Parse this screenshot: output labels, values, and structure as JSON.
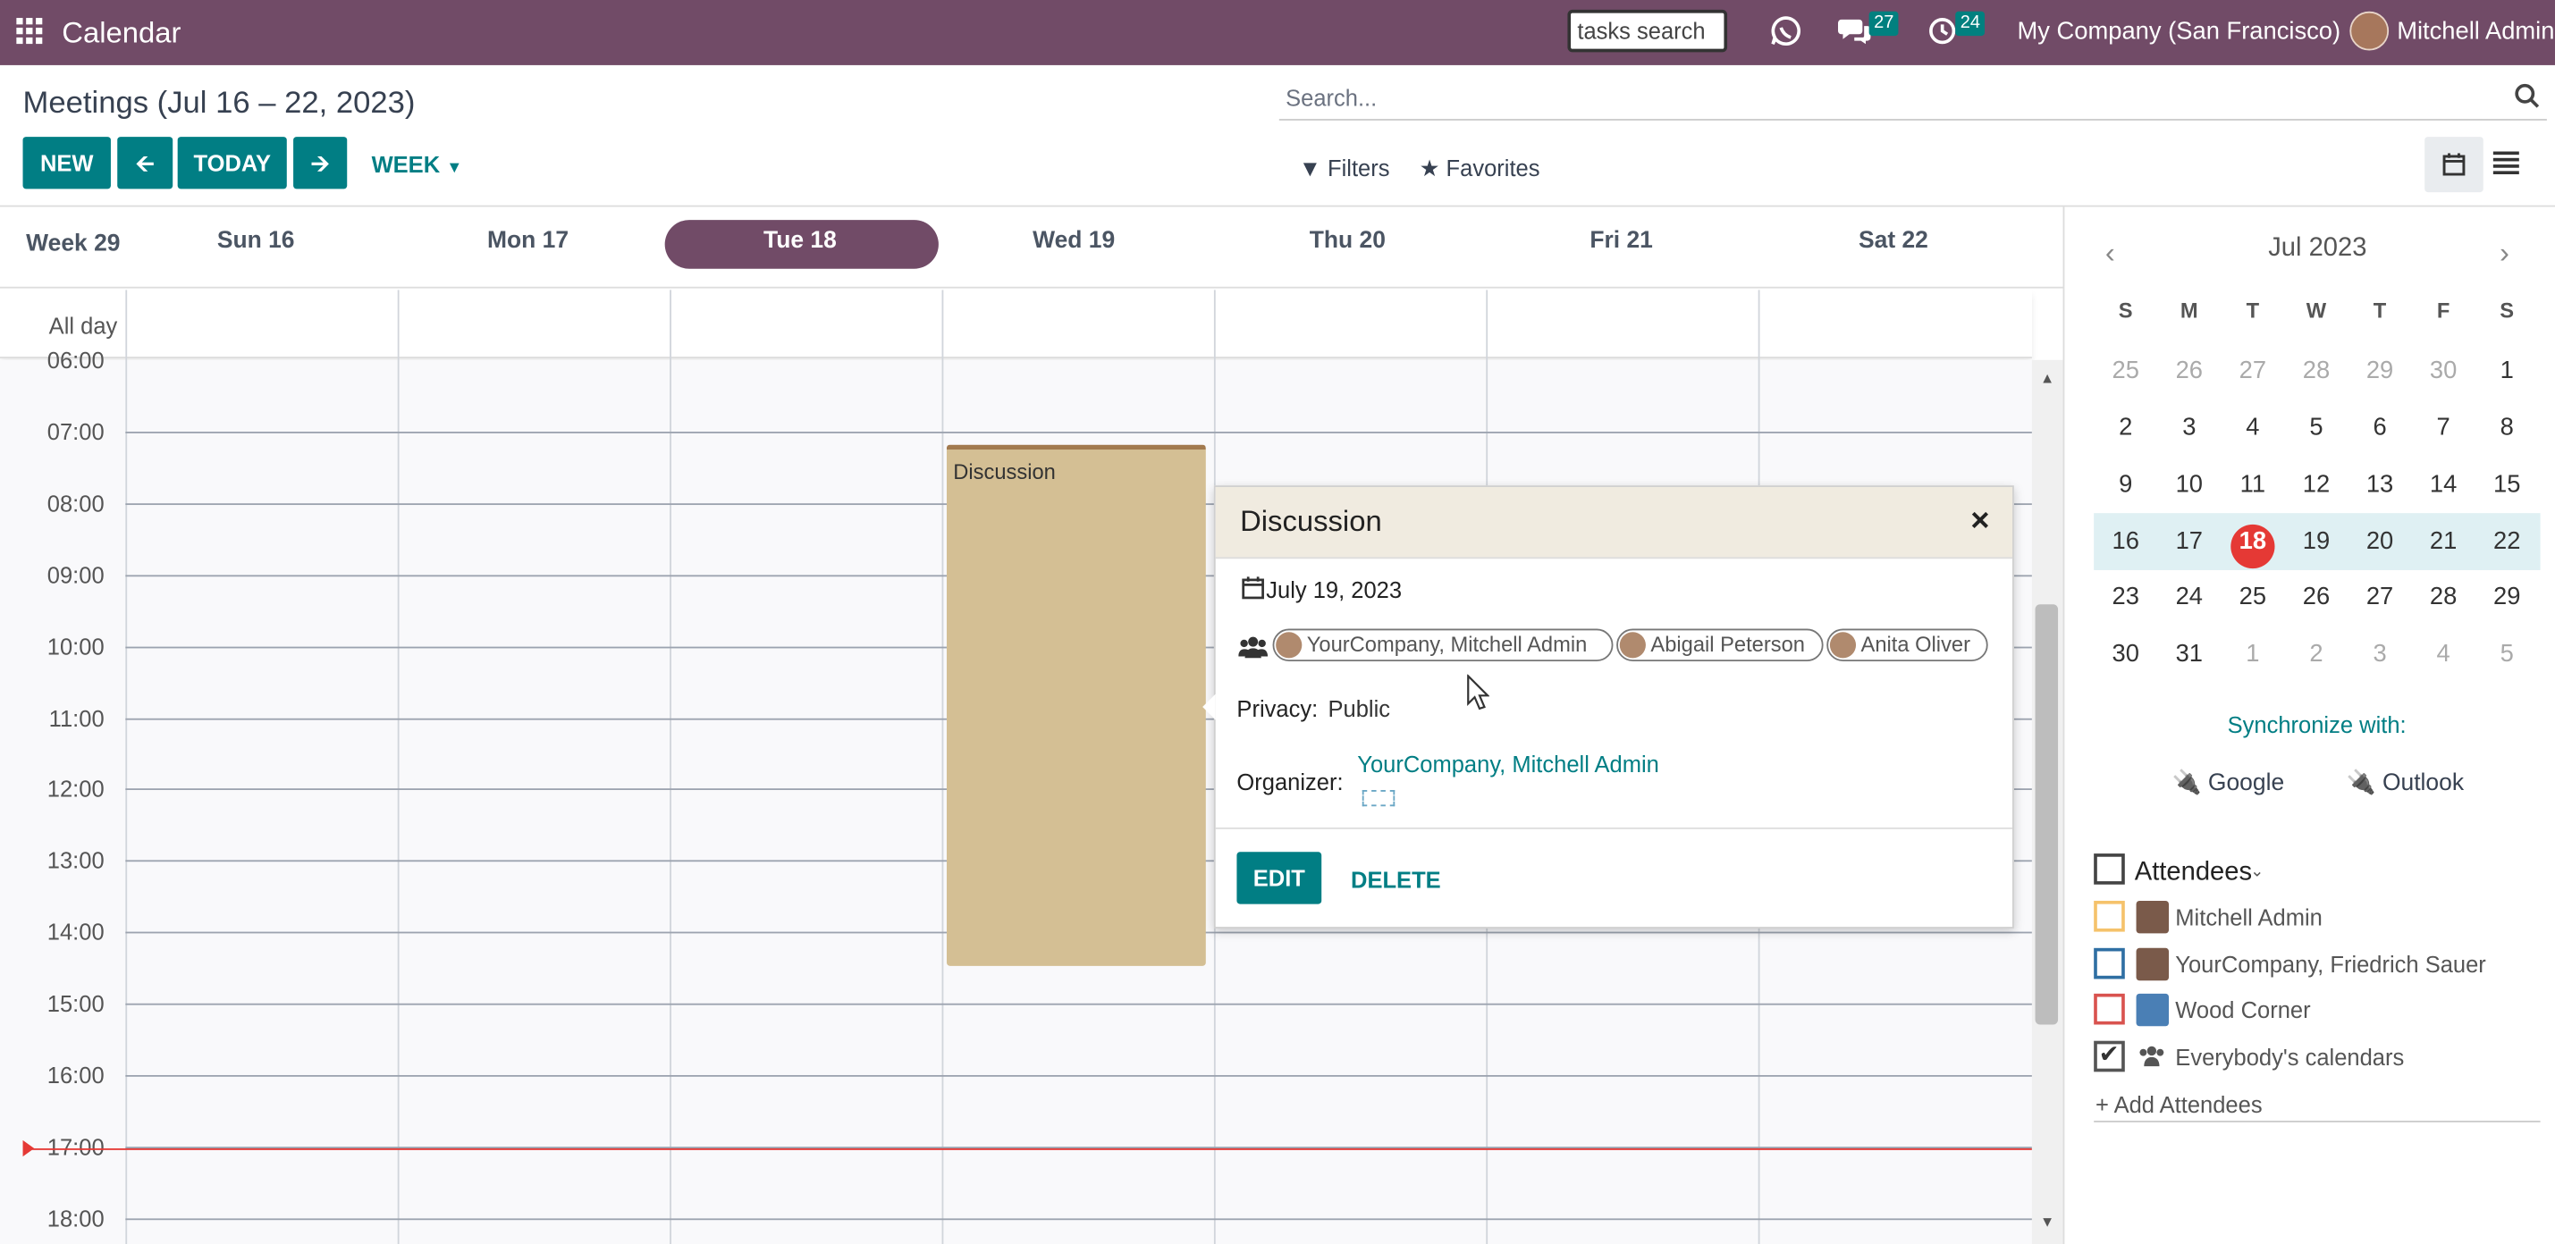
{
  "navbar": {
    "app_title": "Calendar",
    "tasks_search_value": "tasks search",
    "messages_count": "27",
    "activities_count": "24",
    "company": "My Company (San Francisco)",
    "user": "Mitchell Admin"
  },
  "control": {
    "breadcrumb": "Meetings (Jul 16 – 22, 2023)",
    "new_label": "NEW",
    "today_label": "TODAY",
    "scale_label": "WEEK",
    "search_placeholder": "Search...",
    "filters_label": "Filters",
    "favorites_label": "Favorites"
  },
  "calendar": {
    "week_label": "Week 29",
    "days": [
      "Sun 16",
      "Mon 17",
      "Tue 18",
      "Wed 19",
      "Thu 20",
      "Fri 21",
      "Sat 22"
    ],
    "today_index": 2,
    "allday_label": "All day",
    "hours": [
      "06:00",
      "07:00",
      "08:00",
      "09:00",
      "10:00",
      "11:00",
      "12:00",
      "13:00",
      "14:00",
      "15:00",
      "16:00",
      "17:00",
      "18:00"
    ],
    "event": {
      "title": "Discussion",
      "color": "#d4bf94",
      "top_color": "#a27a4f"
    },
    "now_line_color": "#e53935"
  },
  "popover": {
    "title": "Discussion",
    "date": "July 19, 2023",
    "attendees": [
      "YourCompany, Mitchell Admin",
      "Abigail Peterson",
      "Anita Oliver"
    ],
    "privacy_label": "Privacy:",
    "privacy_value": "Public",
    "organizer_label": "Organizer:",
    "organizer_value": "YourCompany, Mitchell Admin",
    "edit_label": "EDIT",
    "delete_label": "DELETE"
  },
  "sidebar": {
    "month_title": "Jul 2023",
    "weekday_headers": [
      "S",
      "M",
      "T",
      "W",
      "T",
      "F",
      "S"
    ],
    "weeks": [
      [
        "25",
        "26",
        "27",
        "28",
        "29",
        "30",
        "1"
      ],
      [
        "2",
        "3",
        "4",
        "5",
        "6",
        "7",
        "8"
      ],
      [
        "9",
        "10",
        "11",
        "12",
        "13",
        "14",
        "15"
      ],
      [
        "16",
        "17",
        "18",
        "19",
        "20",
        "21",
        "22"
      ],
      [
        "23",
        "24",
        "25",
        "26",
        "27",
        "28",
        "29"
      ],
      [
        "30",
        "31",
        "1",
        "2",
        "3",
        "4",
        "5"
      ]
    ],
    "today": "18",
    "sync_label": "Synchronize with:",
    "google_label": "Google",
    "outlook_label": "Outlook",
    "attendees_title": "Attendees",
    "attendees": [
      {
        "name": "Mitchell Admin",
        "color": "#f5c26b",
        "checked": false
      },
      {
        "name": "YourCompany, Friedrich Sauer",
        "color": "#2f6fa3",
        "checked": false
      },
      {
        "name": "Wood Corner",
        "color": "#d9534f",
        "checked": false
      },
      {
        "name": "Everybody's calendars",
        "color": "#555555",
        "checked": true
      }
    ],
    "add_attendees_label": "+ Add Attendees"
  },
  "colors": {
    "brand": "#714b67",
    "primary": "#017e84"
  }
}
